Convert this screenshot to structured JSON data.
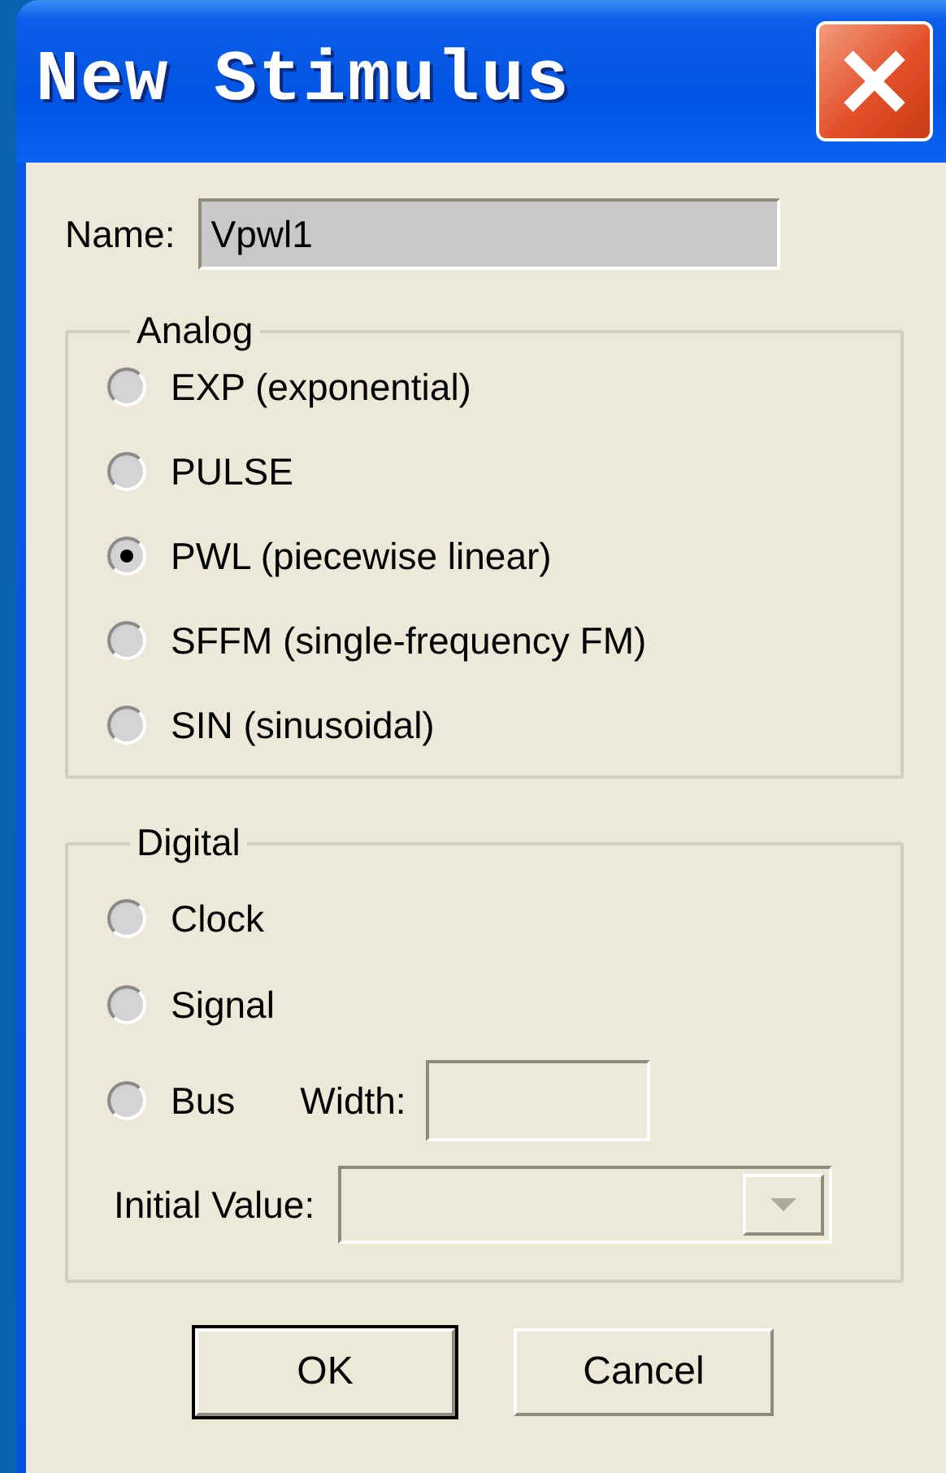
{
  "window": {
    "title": "New Stimulus"
  },
  "name_field": {
    "label": "Name:",
    "value": "Vpwl1"
  },
  "analog": {
    "title": "Analog",
    "options": [
      {
        "label": "EXP (exponential)",
        "selected": false
      },
      {
        "label": "PULSE",
        "selected": false
      },
      {
        "label": "PWL (piecewise linear)",
        "selected": true
      },
      {
        "label": "SFFM (single-frequency FM)",
        "selected": false
      },
      {
        "label": "SIN (sinusoidal)",
        "selected": false
      }
    ]
  },
  "digital": {
    "title": "Digital",
    "options": [
      {
        "label": "Clock",
        "selected": false
      },
      {
        "label": "Signal",
        "selected": false
      },
      {
        "label": "Bus",
        "selected": false
      }
    ],
    "width_label": "Width:",
    "initial_value_label": "Initial Value:"
  },
  "buttons": [
    {
      "label": "OK",
      "default": true
    },
    {
      "label": "Cancel",
      "default": false
    }
  ]
}
